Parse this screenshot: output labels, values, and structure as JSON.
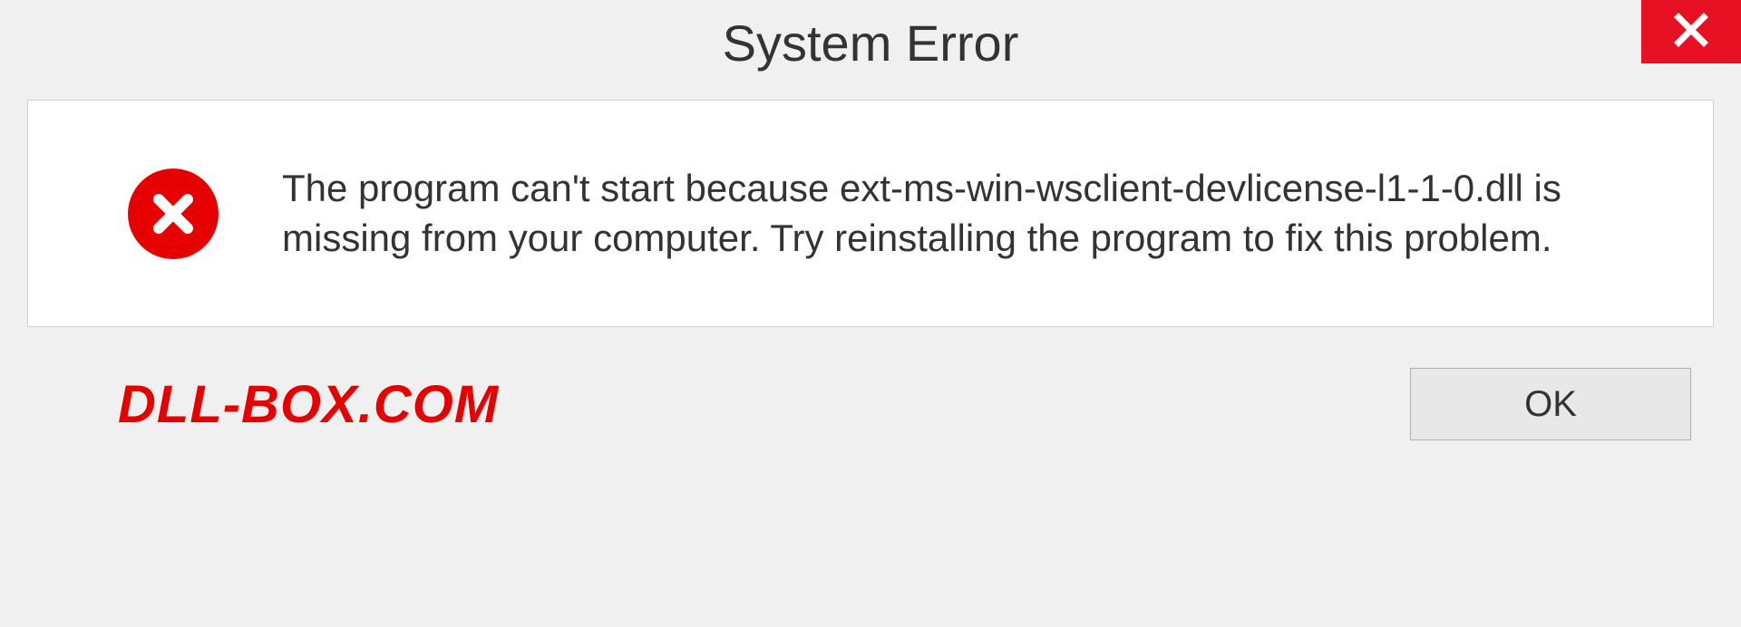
{
  "titlebar": {
    "title": "System Error"
  },
  "content": {
    "message": "The program can't start because ext-ms-win-wsclient-devlicense-l1-1-0.dll is missing from your computer. Try reinstalling the program to fix this problem."
  },
  "footer": {
    "watermark": "DLL-BOX.COM",
    "ok_label": "OK"
  },
  "colors": {
    "error_red": "#e60000",
    "close_red": "#e81123"
  }
}
